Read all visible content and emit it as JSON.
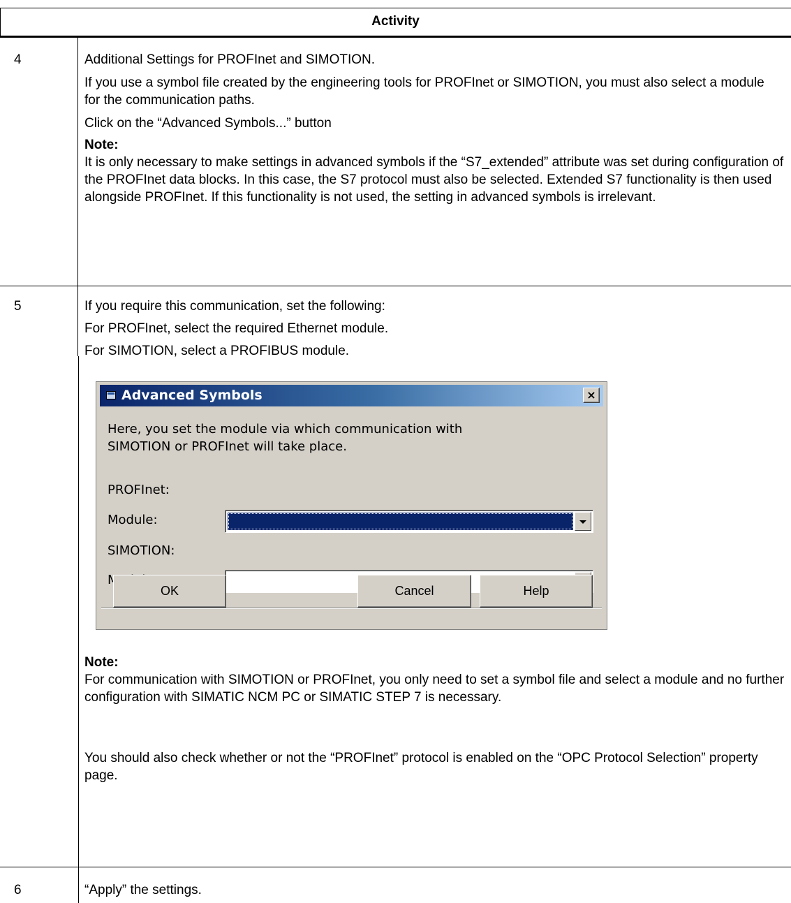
{
  "table": {
    "header": "Activity",
    "rows": [
      {
        "step": "4",
        "paragraphs": [
          "Additional Settings for PROFInet and SIMOTION.",
          "If you use a symbol file created by the engineering tools for PROFInet or SIMOTION, you must also select a module for the communication paths.",
          "Click on the “Advanced Symbols...” button"
        ],
        "note_label": "Note:",
        "note_text": "It is only necessary to make settings in advanced symbols if the “S7_extended” attribute was set during configuration of the PROFInet data blocks. In this case, the S7 protocol must also be selected. Extended S7 functionality is then used alongside PROFInet. If this functionality is not used, the setting in advanced symbols is irrelevant."
      },
      {
        "step": "5",
        "paragraphs": [
          "If you require this communication, set the following:",
          "For PROFInet, select the required Ethernet module.",
          "For SIMOTION, select a PROFIBUS module."
        ],
        "note_label": "Note:",
        "note_text": "For communication with SIMOTION or PROFInet, you only need to set a symbol file and select a module and no further configuration with SIMATIC NCM PC or SIMATIC STEP 7 is necessary.",
        "after_note": "You should also check whether or not the “PROFInet” protocol is enabled on the “OPC Protocol Selection” property page."
      },
      {
        "step": "6",
        "paragraphs": [
          "“Apply” the settings."
        ]
      }
    ]
  },
  "dialog": {
    "title": "Advanced Symbols",
    "close_glyph": "×",
    "description": "Here, you set the module via which communication with SIMOTION or PROFInet will take place.",
    "profinet_group": "PROFInet:",
    "profinet_module_label": "Module:",
    "profinet_module_value": "",
    "simotion_group": "SIMOTION:",
    "simotion_module_label": "Module:",
    "simotion_module_value": "",
    "ok_label": "OK",
    "cancel_label": "Cancel",
    "help_label": "Help"
  }
}
